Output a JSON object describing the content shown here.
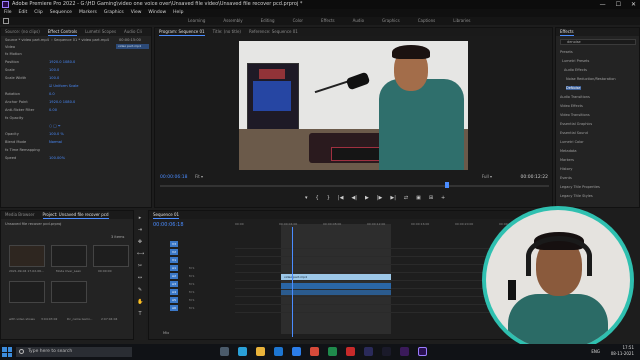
{
  "window": {
    "title": "Adobe Premiere Pro 2022 - G:\\HD Gaming\\video one voice over\\Unsaved file video\\Unsaved file recover pcd.prproj *",
    "controls": [
      "—",
      "☐",
      "✕"
    ]
  },
  "menu": [
    "File",
    "Edit",
    "Clip",
    "Sequence",
    "Markers",
    "Graphics",
    "View",
    "Window",
    "Help"
  ],
  "workspaces": [
    "Learning",
    "Assembly",
    "Editing",
    "Color",
    "Effects",
    "Audio",
    "Graphics",
    "Captions",
    "Libraries"
  ],
  "source_panel": {
    "tabs": [
      "Source: (no clips)",
      "Effect Controls",
      "Lumetri Scopes",
      "Audio Cli"
    ],
    "header_path": "Source * video part.mp4",
    "sequence_ref": "Sequence 01 * video part.mp4",
    "clip_bar_label": "video part.mp4",
    "clip_tc": "00:00:15:00",
    "section_video": "Video",
    "rows": [
      {
        "label": "fx  Motion",
        "value": ""
      },
      {
        "label": "Position",
        "value": "1920.0     1080.0"
      },
      {
        "label": "Scale",
        "value": "100.0"
      },
      {
        "label": "Scale Width",
        "value": "100.0"
      },
      {
        "label": "",
        "value": "☑ Uniform Scale"
      },
      {
        "label": "Rotation",
        "value": "0.0"
      },
      {
        "label": "Anchor Point",
        "value": "1920.0     1080.0"
      },
      {
        "label": "Anti-flicker Filter",
        "value": "0.00"
      },
      {
        "label": "fx  Opacity",
        "value": ""
      },
      {
        "label": "",
        "value": "○ □ ✒"
      },
      {
        "label": "Opacity",
        "value": "100.0 %"
      },
      {
        "label": "Blend Mode",
        "value": "Normal"
      },
      {
        "label": "fx  Time Remapping",
        "value": ""
      },
      {
        "label": "Speed",
        "value": "100.00%"
      }
    ]
  },
  "program_panel": {
    "tabs": [
      "Program: Sequence 01",
      "Title: (no title)",
      "Reference: Sequence 01"
    ],
    "timecode": "00:00:06:18",
    "fit": "Fit",
    "quality": "Full",
    "duration": "00:00:12:22",
    "transport": [
      "▾",
      "{",
      "}",
      "|◀",
      "◀|",
      "▶",
      "|▶",
      "▶|",
      "⇄",
      "▣",
      "⊞",
      "+"
    ]
  },
  "effects_panel": {
    "tab": "Effects",
    "search": "denoise",
    "items": [
      {
        "label": "Presets",
        "selected": false
      },
      {
        "label": "Lumetri Presets",
        "selected": false
      },
      {
        "label": "Audio Effects",
        "selected": false
      },
      {
        "label": "Noise Reduction/Restoration",
        "selected": false
      },
      {
        "label": "DeNoise",
        "selected": true
      },
      {
        "label": "Audio Transitions",
        "selected": false
      },
      {
        "label": "Video Effects",
        "selected": false
      },
      {
        "label": "Video Transitions",
        "selected": false
      },
      {
        "label": "Essential Graphics",
        "selected": false
      },
      {
        "label": "Essential Sound",
        "selected": false
      },
      {
        "label": "Lumetri Color",
        "selected": false
      },
      {
        "label": "Metadata",
        "selected": false
      },
      {
        "label": "Markers",
        "selected": false
      },
      {
        "label": "History",
        "selected": false
      },
      {
        "label": "Events",
        "selected": false
      },
      {
        "label": "Legacy Title Properties",
        "selected": false
      },
      {
        "label": "Legacy Title Styles",
        "selected": false
      }
    ]
  },
  "project_panel": {
    "tabs": [
      "Media Browser",
      "Project: Unsaved file recover pcd"
    ],
    "filename": "Unsaved file recover pcd.prproj",
    "count": "3 items",
    "thumbs": [
      {
        "label": "2021-09-04 17-02-06...",
        "meta": "16:13:03"
      },
      {
        "label": "Mode Over_Lean",
        "meta": "00:00:00"
      },
      {
        "label": "Mode Over_Lean",
        "meta": "00:00:00"
      },
      {
        "label": "Mode Over_Lean",
        "meta": "00:00:00"
      }
    ],
    "footer": [
      "with video shows",
      "3:04:03:02",
      "Dc_came Gami...",
      "2:07:04:04"
    ]
  },
  "tools": [
    "▸",
    "⇥",
    "✥",
    "⟷",
    "✂",
    "↔",
    "✎",
    "✋",
    "T"
  ],
  "timeline_panel": {
    "tab": "Sequence 01",
    "timecode": "00:00:06:18",
    "ruler": [
      "00:00",
      "00:00:04:00",
      "00:00:08:00",
      "00:00:12:00",
      "00:00:16:00",
      "00:00:20:00",
      "00:00:24:00",
      "00:00:28:00"
    ],
    "video_tracks": [
      "V3",
      "V2",
      "V1"
    ],
    "audio_tracks": [
      "A1",
      "A2",
      "A3",
      "A4",
      "A5",
      "A6"
    ],
    "video_clip": "video part.mp4",
    "track_controls": "M S",
    "mix": "Mix"
  },
  "taskbar": {
    "search": "Type here to search",
    "lang": "ENG",
    "time": "17:51",
    "date": "08-11-2021"
  },
  "colors": {
    "accent": "#4a8cff",
    "clip_video": "#9cc7e8",
    "clip_audio": "#2a66a6",
    "webcam_ring": "#2fc0b0"
  }
}
